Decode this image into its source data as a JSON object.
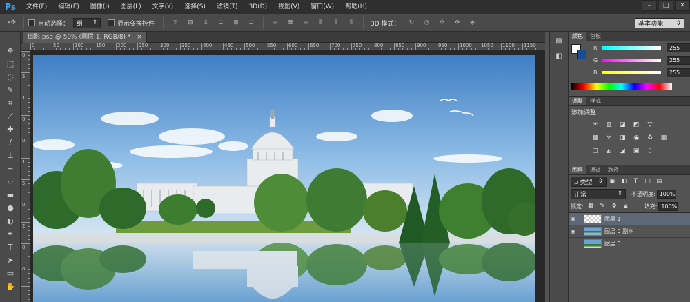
{
  "app": {
    "logo": "Ps"
  },
  "menu": [
    "文件(F)",
    "编辑(E)",
    "图像(I)",
    "图层(L)",
    "文字(Y)",
    "选择(S)",
    "滤镜(T)",
    "3D(D)",
    "视图(V)",
    "窗口(W)",
    "帮助(H)"
  ],
  "window_buttons": [
    "–",
    "□",
    "✕"
  ],
  "options": {
    "auto_select_label": "自动选择：",
    "auto_select_value": "组",
    "show_transform_label": "显示变换控件",
    "mode_3d_label": "3D 模式：",
    "workspace": "基本功能"
  },
  "document": {
    "tab_title": "倒影.psd @ 50% (图层 1, RGB/8) *",
    "tab_close": "×"
  },
  "ruler": {
    "h": [
      "0",
      "50",
      "100",
      "150",
      "200",
      "250",
      "300",
      "350",
      "400",
      "450",
      "500",
      "550",
      "600",
      "650",
      "700",
      "750",
      "800",
      "850",
      "900",
      "950",
      "1000",
      "1050",
      "1100",
      "1150"
    ],
    "v": [
      "0",
      "5",
      "1",
      "0",
      "0",
      "1",
      "5",
      "0",
      "2",
      "0",
      "0"
    ]
  },
  "color_panel": {
    "tabs": [
      "颜色",
      "色板"
    ],
    "channels": [
      {
        "label": "R",
        "value": "255",
        "color": "#e74c3c"
      },
      {
        "label": "G",
        "value": "255",
        "color": "#e62ee6"
      },
      {
        "label": "B",
        "value": "255",
        "color": "#e6e600"
      }
    ]
  },
  "adjust_panel": {
    "tabs": [
      "调整",
      "样式"
    ],
    "title": "添加调整"
  },
  "layers_panel": {
    "tabs": [
      "图层",
      "通道",
      "路径"
    ],
    "filter_kind": "ρ 类型",
    "blend_mode": "正常",
    "opacity_label": "不透明度:",
    "opacity_value": "100%",
    "lock_label": "锁定:",
    "fill_label": "填充:",
    "fill_value": "100%",
    "layers": [
      {
        "name": "图层 1",
        "visible": true,
        "selected": true
      },
      {
        "name": "图层 0 副本",
        "visible": true,
        "selected": false
      },
      {
        "name": "图层 0",
        "visible": false,
        "selected": false
      }
    ]
  },
  "icons": {
    "tools": [
      "move-tool-icon",
      "marquee-tool-icon",
      "lasso-tool-icon",
      "quick-select-tool-icon",
      "crop-tool-icon",
      "eyedropper-tool-icon",
      "healing-brush-tool-icon",
      "brush-tool-icon",
      "clone-stamp-tool-icon",
      "history-brush-tool-icon",
      "eraser-tool-icon",
      "gradient-tool-icon",
      "blur-tool-icon",
      "dodge-tool-icon",
      "pen-tool-icon",
      "type-tool-icon",
      "path-select-tool-icon",
      "rectangle-tool-icon",
      "hand-tool-icon"
    ]
  }
}
